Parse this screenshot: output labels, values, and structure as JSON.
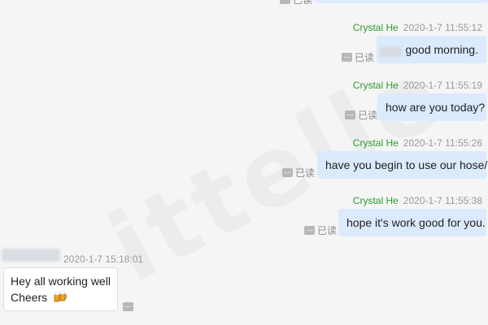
{
  "read_label": "已读",
  "messages_out": [
    {
      "sender": "Crystal He",
      "time": "2020-1-7 11:55:12",
      "text": "good morning."
    },
    {
      "sender": "Crystal He",
      "time": "2020-1-7 11:55:19",
      "text": "how are you today?"
    },
    {
      "sender": "Crystal He",
      "time": "2020-1-7 11:55:26",
      "text": "have you begin to use our hose/"
    },
    {
      "sender": "Crystal He",
      "time": "2020-1-7 11:55:38",
      "text": "hope it's work good for you."
    }
  ],
  "message_in": {
    "time": "2020-1-7 15:18:01",
    "line1": "Hey all working well",
    "line2": "Cheers"
  },
  "icons": {
    "read_status": "message-icon",
    "emoji": "beer-mugs-icon"
  }
}
